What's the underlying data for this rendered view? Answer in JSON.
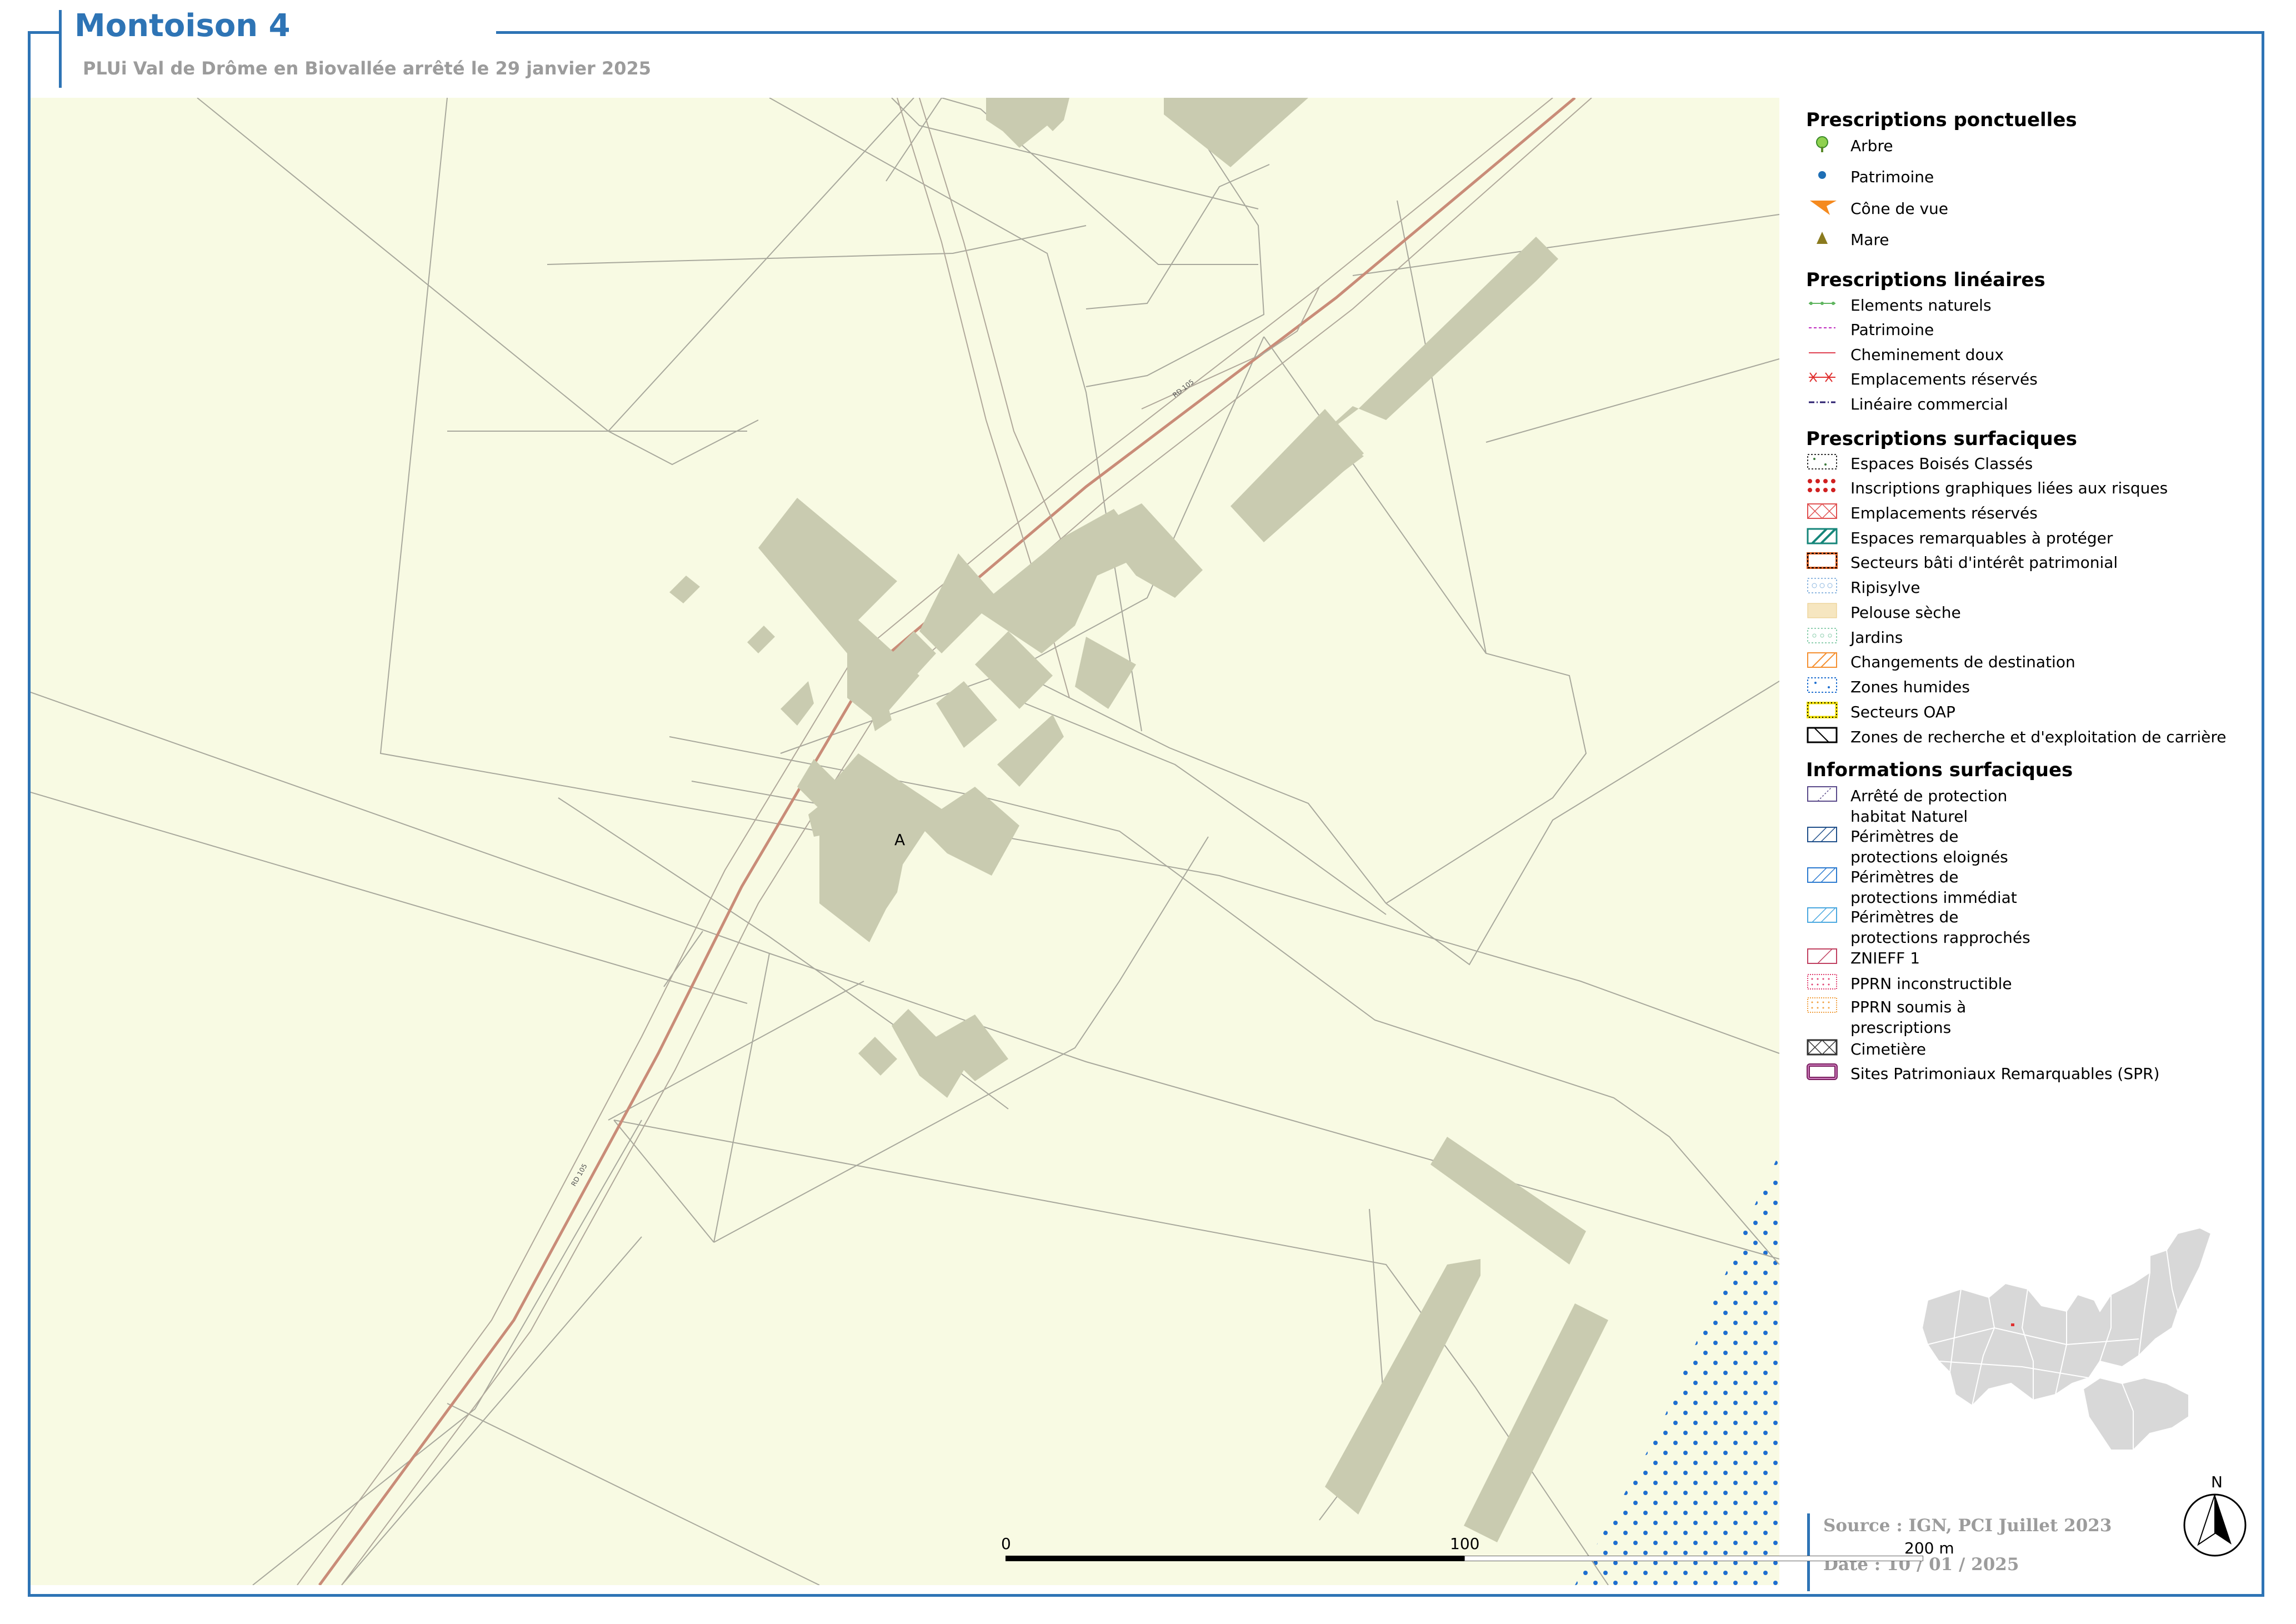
{
  "header": {
    "title": "Montoison 4",
    "subtitle": "PLUi Val de Drôme en Biovallée arrêté le 29 janvier 2025"
  },
  "map": {
    "background_color": "#f8fae3",
    "building_color": "#c9cbb0",
    "road_color": "#c98c78",
    "parcel_line_color": "#a8a89c",
    "label_A": "A",
    "road_labels": [
      "RD 105",
      "RD 105"
    ]
  },
  "legend": {
    "sections": [
      {
        "title": "Prescriptions ponctuelles",
        "items": [
          {
            "label": "Arbre",
            "icon": "tree-icon",
            "color": "#8fd14f"
          },
          {
            "label": "Patrimoine",
            "icon": "dot-icon",
            "color": "#1f6fb5"
          },
          {
            "label": "Cône de vue",
            "icon": "view-cone-icon",
            "color": "#f58a1f"
          },
          {
            "label": "Mare",
            "icon": "triangle-icon",
            "color": "#8a7a1e"
          }
        ]
      },
      {
        "title": "Prescriptions linéaires",
        "items": [
          {
            "label": "Elements naturels",
            "icon": "dotted-line-icon",
            "color": "#5fb55f"
          },
          {
            "label": "Patrimoine",
            "icon": "dashed-line-icon",
            "color": "#c02cc0"
          },
          {
            "label": "Cheminement doux",
            "icon": "line-icon",
            "color": "#e04050"
          },
          {
            "label": "Emplacements réservés",
            "icon": "cross-line-icon",
            "color": "#e03030"
          },
          {
            "label": "Linéaire commercial",
            "icon": "dash-dot-line-icon",
            "color": "#2a1e6e"
          }
        ]
      },
      {
        "title": "Prescriptions surfaciques",
        "items": [
          {
            "label": "Espaces Boisés Classés",
            "icon": "ebc-patch-icon",
            "color": "#3a7a3a"
          },
          {
            "label": "Inscriptions graphiques liées aux risques",
            "icon": "risk-patch-icon",
            "color": "#d02020"
          },
          {
            "label": "Emplacements réservés",
            "icon": "reserved-patch-icon",
            "color": "#e05050"
          },
          {
            "label": "Espaces remarquables à protéger",
            "icon": "remarkable-patch-icon",
            "color": "#16867a"
          },
          {
            "label": "Secteurs bâti d'intérêt patrimonial",
            "icon": "heritage-patch-icon",
            "color": "#a03010"
          },
          {
            "label": "Ripisylve",
            "icon": "ripisylve-patch-icon",
            "color": "#8fb8e0"
          },
          {
            "label": "Pelouse sèche",
            "icon": "dry-lawn-patch-icon",
            "color": "#f0d8a0"
          },
          {
            "label": "Jardins",
            "icon": "garden-patch-icon",
            "color": "#8fd0b0"
          },
          {
            "label": "Changements de destination",
            "icon": "change-patch-icon",
            "color": "#f59030"
          },
          {
            "label": "Zones humides",
            "icon": "wetland-patch-icon",
            "color": "#1f6fd0"
          },
          {
            "label": "Secteurs OAP",
            "icon": "oap-patch-icon",
            "color": "#f0e000"
          },
          {
            "label": "Zones de recherche et d'exploitation de carrière",
            "icon": "quarry-patch-icon",
            "color": "#000000"
          }
        ]
      },
      {
        "title": "Informations surfaciques",
        "items": [
          {
            "label": "Arrêté de protection\nhabitat Naturel",
            "icon": "apb-patch-icon",
            "color": "#5a4a8a"
          },
          {
            "label": "Périmètres de\nprotections eloignés",
            "icon": "far-perimeter-patch-icon",
            "color": "#1f4f8a"
          },
          {
            "label": "Périmètres de\nprotections immédiat",
            "icon": "immediate-perimeter-patch-icon",
            "color": "#2a7ad0"
          },
          {
            "label": "Périmètres de\nprotections rapprochés",
            "icon": "close-perimeter-patch-icon",
            "color": "#4aa8e0"
          },
          {
            "label": "ZNIEFF 1",
            "icon": "znieff-patch-icon",
            "color": "#c04060"
          },
          {
            "label": "PPRN inconstructible",
            "icon": "pprn-red-patch-icon",
            "color": "#e04070"
          },
          {
            "label": "PPRN soumis à\nprescriptions",
            "icon": "pprn-orange-patch-icon",
            "color": "#f0a040"
          },
          {
            "label": "Cimetière",
            "icon": "cemetery-patch-icon",
            "color": "#333333"
          },
          {
            "label": "Sites Patrimoniaux Remarquables (SPR)",
            "icon": "spr-patch-icon",
            "color": "#7a2060"
          }
        ]
      }
    ]
  },
  "footer": {
    "source": "Source : IGN, PCI Juillet 2023",
    "date": "Date : 10 / 01 / 2025"
  },
  "scale": {
    "tick_0": "0",
    "tick_100": "100",
    "tick_200": "200 m"
  },
  "north": {
    "label": "N"
  }
}
